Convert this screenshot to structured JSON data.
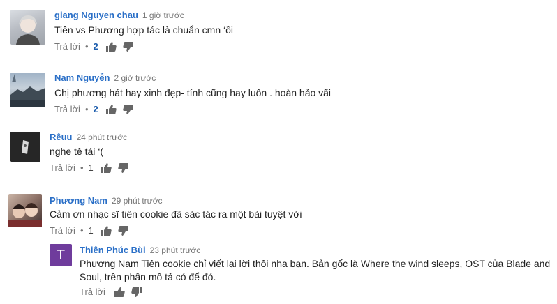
{
  "comments": [
    {
      "author": "giang Nguyen chau",
      "time": "1 giờ trước",
      "text": "Tiên vs Phương hợp tác là chuẩn cmn ‘ồi",
      "reply_label": "Trả lời",
      "separator": "•",
      "likes": "2"
    },
    {
      "author": "Nam Nguyễn",
      "time": "2 giờ trước",
      "text": "Chị phương hát hay xinh đẹp- tính cũng hay luôn . hoàn hảo vãi",
      "reply_label": "Trả lời",
      "separator": "•",
      "likes": "2"
    },
    {
      "author": "Rêuu",
      "time": "24 phút trước",
      "text": "nghe tê tái ‘(",
      "reply_label": "Trả lời",
      "separator": "•",
      "likes": "1"
    },
    {
      "author": "Phương Nam",
      "time": "29 phút trước",
      "text": "Cảm ơn nhạc sĩ tiên cookie đã sác tác ra một bài tuyệt vời",
      "reply_label": "Trả lời",
      "separator": "•",
      "likes": "1"
    }
  ],
  "reply": {
    "avatar_letter": "T",
    "avatar_color": "#6f3c9c",
    "author": "Thiên Phúc Bùi",
    "time": "23 phút trước",
    "text": "Phương Nam Tiên cookie chỉ viết lại lời thôi nha bạn. Bản gốc là Where the wind sleeps, OST của Blade and Soul, trên phần mô tả có để đó.",
    "reply_label": "Trả lời"
  },
  "colors": {
    "author": "#2a6fc7",
    "meta": "#767676",
    "like_count": "#1f5fae"
  },
  "icons": {
    "like": "thumbs-up-icon",
    "dislike": "thumbs-down-icon"
  }
}
